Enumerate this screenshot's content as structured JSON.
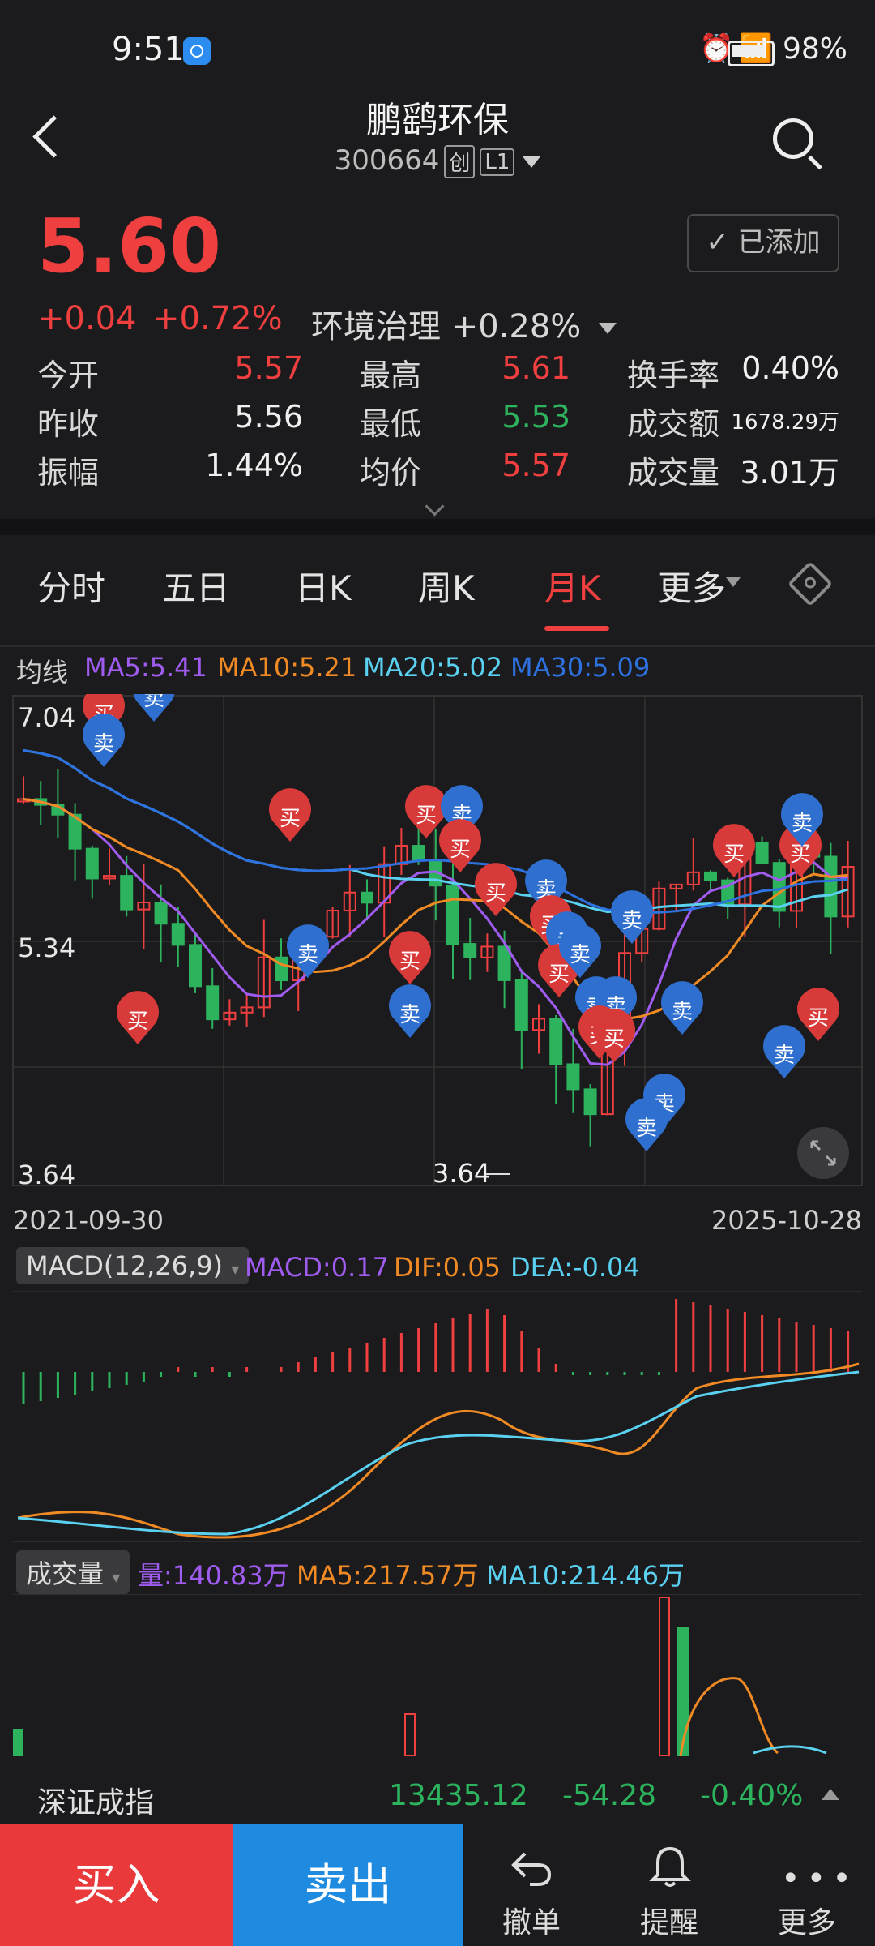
{
  "status": {
    "time": "9:51",
    "battery": "98%",
    "icons": [
      "alarm-icon",
      "wifi-icon",
      "signal-5g-icon",
      "battery-icon"
    ]
  },
  "header": {
    "title": "鹏鹞环保",
    "code": "300664",
    "tag1": "创",
    "tag2": "L1"
  },
  "quote": {
    "price": "5.60",
    "change": "+0.04",
    "change_pct": "+0.72%",
    "sector": "环境治理 +0.28%",
    "added": "已添加",
    "grid": [
      [
        {
          "label": "今开",
          "value": "5.57",
          "color": "red"
        },
        {
          "label": "最高",
          "value": "5.61",
          "color": "red"
        },
        {
          "label": "换手率",
          "value": "0.40%",
          "color": "white"
        }
      ],
      [
        {
          "label": "昨收",
          "value": "5.56",
          "color": "white"
        },
        {
          "label": "最低",
          "value": "5.53",
          "color": "green"
        },
        {
          "label": "成交额",
          "value": "1678.29万",
          "color": "white"
        }
      ],
      [
        {
          "label": "振幅",
          "value": "1.44%",
          "color": "white"
        },
        {
          "label": "均价",
          "value": "5.57",
          "color": "red"
        },
        {
          "label": "成交量",
          "value": "3.01万",
          "color": "white"
        }
      ]
    ]
  },
  "tabs": [
    "分时",
    "五日",
    "日K",
    "周K",
    "月K",
    "更多"
  ],
  "ma_legend": {
    "label": "均线",
    "ma5": "MA5:5.41",
    "ma10": "MA10:5.21",
    "ma20": "MA20:5.02",
    "ma30": "MA30:5.09"
  },
  "colors": {
    "up": "#ef3f3f",
    "down": "#2db35d",
    "ma5": "#a05cf0",
    "ma10": "#f08a24",
    "ma20": "#5ad1f0",
    "ma30": "#2d72e0",
    "buy_marker": "#d83a3a",
    "sell_marker": "#2f6fcf"
  },
  "kline": {
    "y_top_label": "7.04",
    "y_mid_label": "5.34",
    "y_bottom_label": "3.64",
    "low_label": "3.64",
    "start_date": "2021-09-30",
    "end_date": "2025-10-28",
    "buy_label": "买",
    "sell_label": "卖"
  },
  "macd": {
    "chip": "MACD(12,26,9)",
    "macd": "MACD:0.17",
    "dif": "DIF:0.05",
    "dea": "DEA:-0.04"
  },
  "volume": {
    "chip": "成交量",
    "vol": "量:140.83万",
    "ma5": "MA5:217.57万",
    "ma10": "MA10:214.46万"
  },
  "index_bar": {
    "name": "深证成指",
    "value": "13435.12",
    "change": "-54.28",
    "pct": "-0.40%"
  },
  "actions": {
    "buy": "买入",
    "sell": "卖出",
    "cancel": "撤单",
    "alert": "提醒",
    "more": "更多"
  }
}
